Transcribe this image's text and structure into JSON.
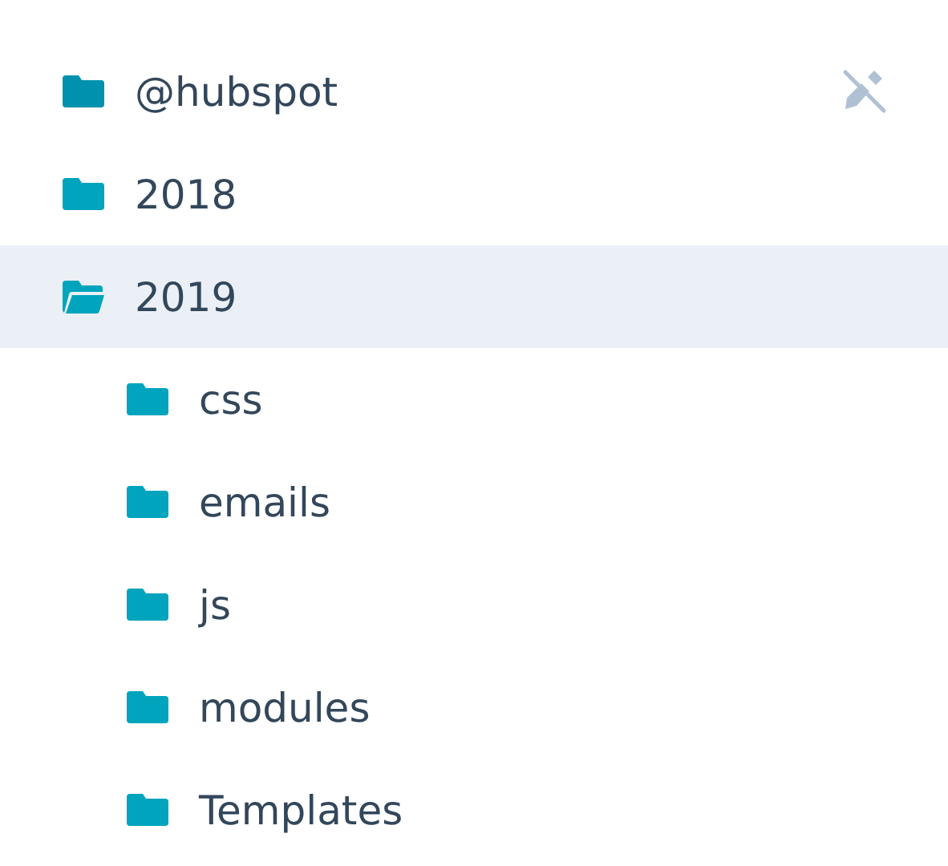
{
  "tree": [
    {
      "name": "@hubspot",
      "read_only": true,
      "expanded": false,
      "selected": false
    },
    {
      "name": "2018",
      "read_only": false,
      "expanded": false,
      "selected": false
    },
    {
      "name": "2019",
      "read_only": false,
      "expanded": true,
      "selected": true,
      "children": [
        {
          "name": "css",
          "read_only": false,
          "expanded": false,
          "selected": false
        },
        {
          "name": "emails",
          "read_only": false,
          "expanded": false,
          "selected": false
        },
        {
          "name": "js",
          "read_only": false,
          "expanded": false,
          "selected": false
        },
        {
          "name": "modules",
          "read_only": false,
          "expanded": false,
          "selected": false
        },
        {
          "name": "Templates",
          "read_only": false,
          "expanded": false,
          "selected": false
        }
      ]
    }
  ]
}
